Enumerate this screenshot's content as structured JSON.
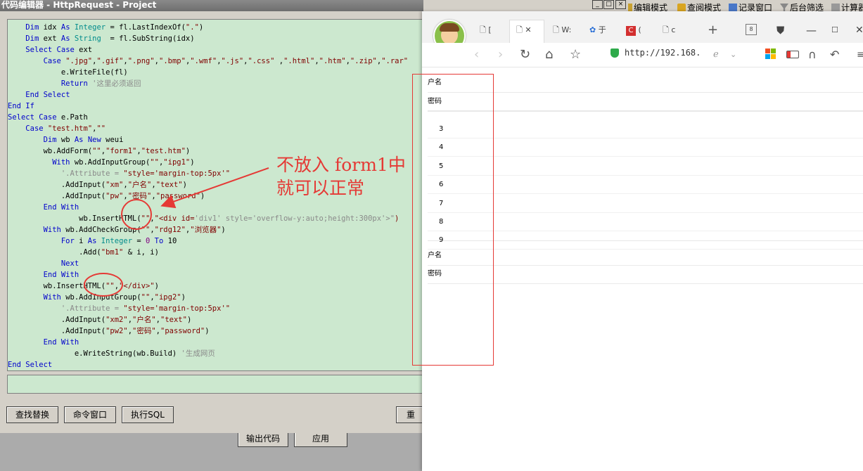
{
  "editor": {
    "title": "代码编辑器 - HttpRequest - Project",
    "code_lines": [
      "    Dim idx As Integer = fl.LastIndexOf(\".\")",
      "    Dim ext As String  = fl.SubString(idx)",
      "    Select Case ext",
      "        Case \".jpg\",\".gif\",\".png\",\".bmp\",\".wmf\",\".js\",\".css\" ,\".html\",\".htm\",\".zip\",\".rar\"",
      "            e.WriteFile(fl)",
      "            Return '这里必须返回",
      "    End Select",
      "End If",
      "Select Case e.Path",
      "    Case \"test.htm\",\"\"",
      "        Dim wb As New weui",
      "        wb.AddForm(\"\",\"form1\",\"test.htm\")",
      "          With wb.AddInputGroup(\"\",\"ipg1\")",
      "            '.Attribute = \"style='margin-top:5px'\"",
      "            .AddInput(\"xm\",\"户名\",\"text\")",
      "            .AddInput(\"pw\",\"密码\",\"password\")",
      "        End With",
      "                wb.InsertHTML(\"\",\"<div id='div1' style='overflow-y:auto;height:300px'>\")",
      "        With wb.AddCheckGroup(\"\",\"rdg12\",\"浏览器\")",
      "            For i As Integer = 0 To 10",
      "                .Add(\"bm1\" & i, i)",
      "            Next",
      "        End With",
      "        wb.InsertHTML(\"\",\"</div>\")",
      "        With wb.AddInputGroup(\"\",\"ipg2\")",
      "            '.Attribute = \"style='margin-top:5px'\"",
      "            .AddInput(\"xm2\",\"户名\",\"text\")",
      "            .AddInput(\"pw2\",\"密码\",\"password\")",
      "        End With",
      "               e.WriteString(wb.Build) '生成网页",
      "End Select"
    ],
    "buttons": {
      "find_replace": "查找替换",
      "command_window": "命令窗口",
      "exec_sql": "执行SQL",
      "reset": "重"
    }
  },
  "background": {
    "buttons": {
      "output_code": "输出代码",
      "apply": "应用"
    },
    "toolbar": {
      "edit_mode": "编辑模式",
      "query_mode": "查阅模式",
      "record_window": "记录窗口",
      "backend_filter": "后台筛选",
      "calc": "计算器"
    }
  },
  "annotation": {
    "line1": "不放入 form1中",
    "line2": "就可以正常"
  },
  "browser": {
    "tabs": [
      "[",
      "",
      "W:",
      "于",
      "(",
      "c"
    ],
    "address": "http://192.168.",
    "form_group1": {
      "username_label": "户名",
      "password_label": "密码"
    },
    "checkbox_items": [
      "3",
      "4",
      "5",
      "6",
      "7",
      "8",
      "9"
    ],
    "form_group2": {
      "username_label": "户名",
      "password_label": "密码"
    }
  },
  "colors": {
    "code_bg": "#cce8cf",
    "annotation": "#e53935",
    "keyword": "#0000cc"
  }
}
